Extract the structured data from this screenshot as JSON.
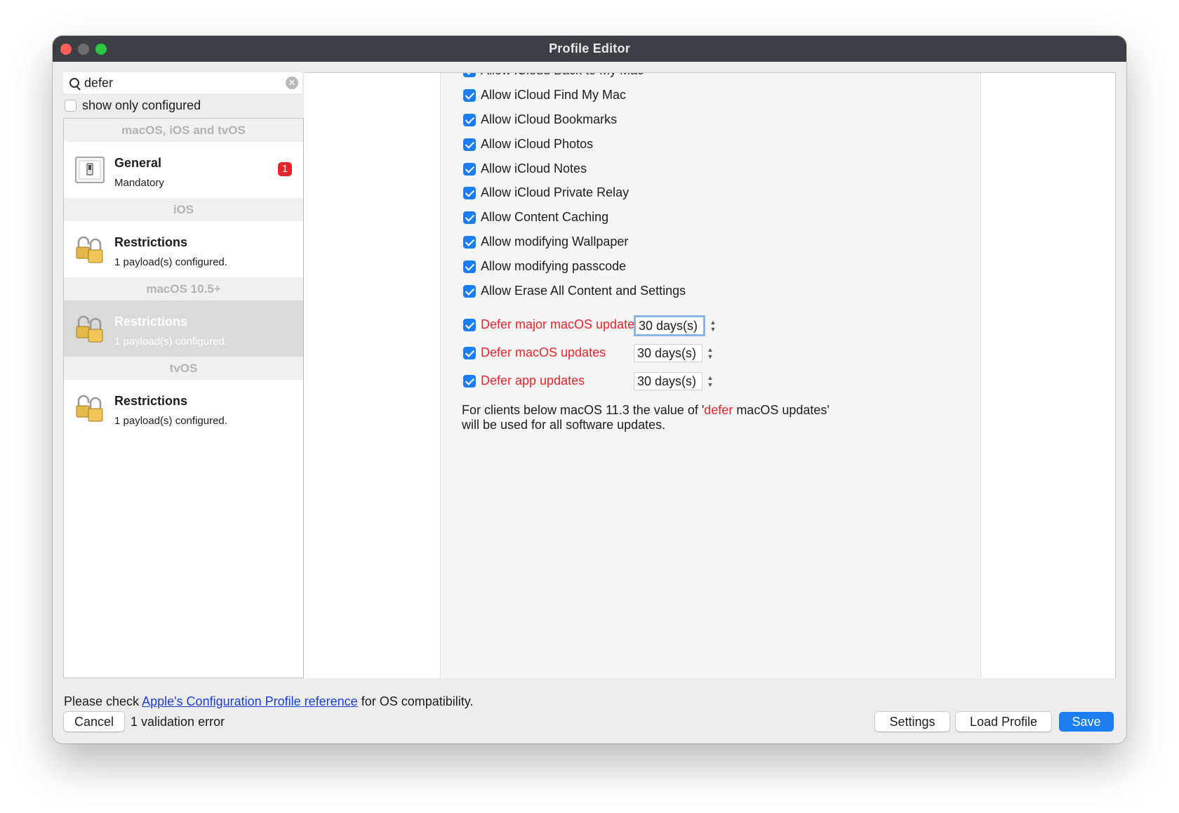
{
  "window": {
    "title": "Profile Editor"
  },
  "sidebar": {
    "search": {
      "value": "defer",
      "placeholder": ""
    },
    "show_only_configured": "show only configured",
    "sections": [
      {
        "header": "macOS, iOS and tvOS",
        "item": {
          "title": "General",
          "subtitle": "Mandatory",
          "badge": "1",
          "icon": "switch-icon"
        }
      },
      {
        "header": "iOS",
        "item": {
          "title": "Restrictions",
          "subtitle": "1 payload(s) configured.",
          "icon": "padlocks-icon"
        }
      },
      {
        "header": "macOS 10.5+",
        "item": {
          "title": "Restrictions",
          "subtitle": "1 payload(s) configured.",
          "icon": "padlocks-icon",
          "selected": true
        }
      },
      {
        "header": "tvOS",
        "item": {
          "title": "Restrictions",
          "subtitle": "1 payload(s) configured.",
          "icon": "padlocks-icon"
        }
      }
    ]
  },
  "content": {
    "partial_top_item": "Allow iCloud Back to My Mac",
    "options": [
      "Allow iCloud Find My Mac",
      "Allow iCloud Bookmarks",
      "Allow iCloud Photos",
      "Allow iCloud Notes",
      "Allow iCloud Private Relay",
      "Allow Content Caching",
      "Allow modifying Wallpaper",
      "Allow modifying passcode",
      "Allow Erase All Content and Settings"
    ],
    "defer_options": [
      {
        "label": "Defer major macOS updates",
        "value": "30 days(s)"
      },
      {
        "label": "Defer macOS updates",
        "value": "30 days(s)"
      },
      {
        "label": "Defer app updates",
        "value": "30 days(s)"
      }
    ],
    "note": {
      "part1": "For clients below macOS 11.3 the value of '",
      "red_word": "defer",
      "part2": " macOS updates'",
      "line2": "will be used for all software updates."
    }
  },
  "footer": {
    "note_prefix": "Please check ",
    "note_link": "Apple's Configuration Profile reference",
    "note_suffix": " for OS compatibility.",
    "cancel": "Cancel",
    "validation": "1 validation error",
    "settings": "Settings",
    "load_profile": "Load Profile",
    "save": "Save"
  },
  "colors": {
    "accent": "#1a7df0",
    "error": "#e8242a",
    "link": "#1a3fd6"
  }
}
